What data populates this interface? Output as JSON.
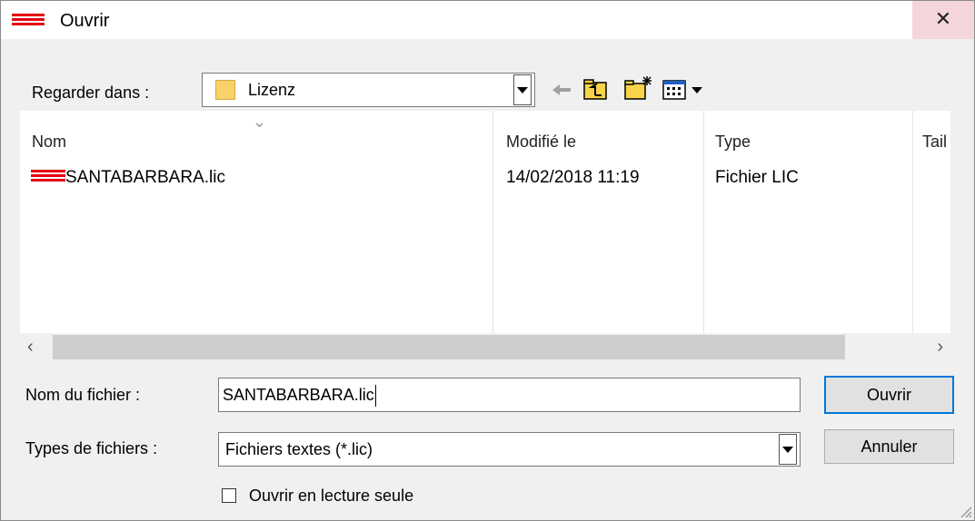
{
  "window": {
    "title": "Ouvrir",
    "close_glyph": "✕"
  },
  "lookin": {
    "label": "Regarder dans :",
    "value": "Lizenz"
  },
  "toolbar": {
    "icons": [
      "back-arrow-icon",
      "up-folder-icon",
      "new-folder-icon",
      "view-menu-icon"
    ]
  },
  "filelist": {
    "columns": [
      "Nom",
      "Modifié le",
      "Type",
      "Tail"
    ],
    "rows": [
      {
        "name": "SANTABARBARA.lic",
        "modified": "14/02/2018 11:19",
        "type": "Fichier LIC"
      }
    ],
    "scroll_left": "‹",
    "scroll_right": "›"
  },
  "filename": {
    "label": "Nom du fichier :",
    "value": "SANTABARBARA.lic"
  },
  "filetypes": {
    "label": "Types de fichiers :",
    "value": "Fichiers textes (*.lic)"
  },
  "buttons": {
    "open": "Ouvrir",
    "cancel": "Annuler"
  },
  "readonly": {
    "label": "Ouvrir en lecture seule",
    "checked": false
  },
  "colors": {
    "brand_red": "#e30613",
    "focus_blue": "#0078d7"
  }
}
